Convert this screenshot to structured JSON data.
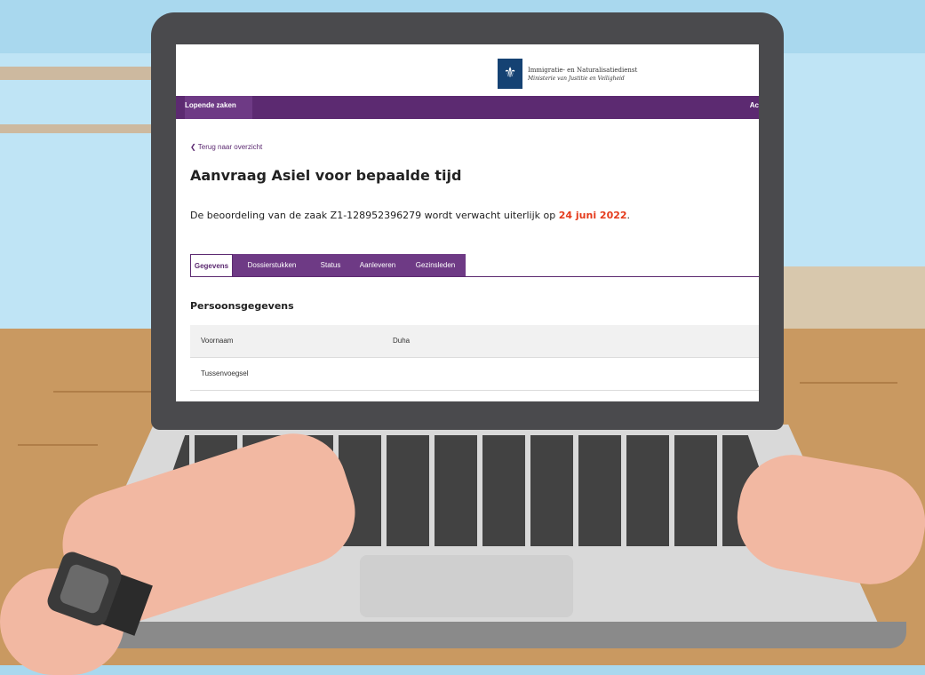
{
  "org": {
    "logo_glyph": "⚜",
    "name": "Immigratie- en Naturalisatiedienst",
    "subtitle": "Ministerie van Justitie en Veiligheid"
  },
  "nav": {
    "active": "Lopende zaken",
    "right": "Ac"
  },
  "back_link": "❮ Terug naar overzicht",
  "page_title": "Aanvraag Asiel voor bepaalde tijd",
  "message": {
    "prefix": "De beoordeling van de zaak Z1-128952396279 wordt verwacht uiterlijk op ",
    "deadline": "24 juni 2022",
    "suffix": "."
  },
  "tabs": [
    "Gegevens",
    "Dossierstukken",
    "Status",
    "Aanleveren",
    "Gezinsleden"
  ],
  "section_title": "Persoonsgegevens",
  "rows": [
    {
      "label": "Voornaam",
      "value": "Duha"
    },
    {
      "label": "Tussenvoegsel",
      "value": ""
    }
  ],
  "colors": {
    "brand_purple": "#5c2a71",
    "deadline_red": "#e53b1c",
    "logo_blue": "#154273"
  }
}
